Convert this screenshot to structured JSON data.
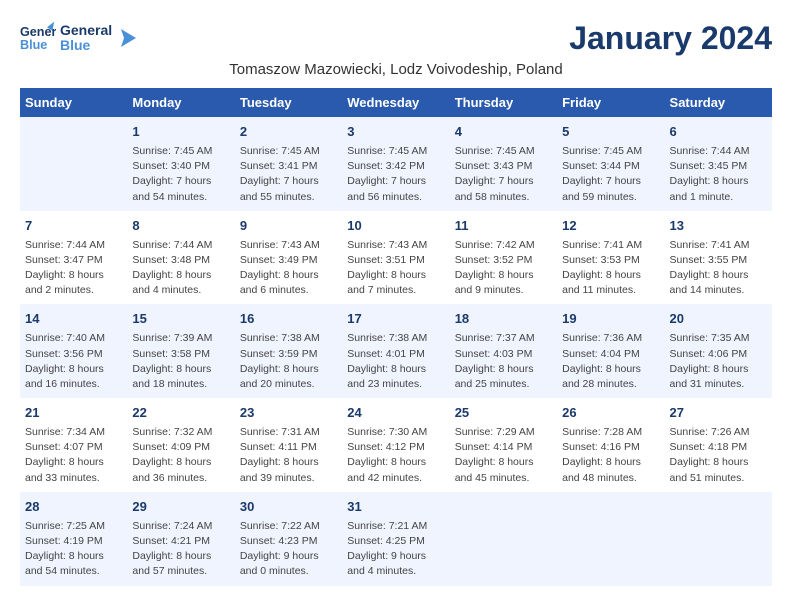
{
  "logo": {
    "line1": "General",
    "line2": "Blue"
  },
  "title": "January 2024",
  "subtitle": "Tomaszow Mazowiecki, Lodz Voivodeship, Poland",
  "days_of_week": [
    "Sunday",
    "Monday",
    "Tuesday",
    "Wednesday",
    "Thursday",
    "Friday",
    "Saturday"
  ],
  "weeks": [
    [
      {
        "day": "",
        "info": ""
      },
      {
        "day": "1",
        "info": "Sunrise: 7:45 AM\nSunset: 3:40 PM\nDaylight: 7 hours\nand 54 minutes."
      },
      {
        "day": "2",
        "info": "Sunrise: 7:45 AM\nSunset: 3:41 PM\nDaylight: 7 hours\nand 55 minutes."
      },
      {
        "day": "3",
        "info": "Sunrise: 7:45 AM\nSunset: 3:42 PM\nDaylight: 7 hours\nand 56 minutes."
      },
      {
        "day": "4",
        "info": "Sunrise: 7:45 AM\nSunset: 3:43 PM\nDaylight: 7 hours\nand 58 minutes."
      },
      {
        "day": "5",
        "info": "Sunrise: 7:45 AM\nSunset: 3:44 PM\nDaylight: 7 hours\nand 59 minutes."
      },
      {
        "day": "6",
        "info": "Sunrise: 7:44 AM\nSunset: 3:45 PM\nDaylight: 8 hours\nand 1 minute."
      }
    ],
    [
      {
        "day": "7",
        "info": "Sunrise: 7:44 AM\nSunset: 3:47 PM\nDaylight: 8 hours\nand 2 minutes."
      },
      {
        "day": "8",
        "info": "Sunrise: 7:44 AM\nSunset: 3:48 PM\nDaylight: 8 hours\nand 4 minutes."
      },
      {
        "day": "9",
        "info": "Sunrise: 7:43 AM\nSunset: 3:49 PM\nDaylight: 8 hours\nand 6 minutes."
      },
      {
        "day": "10",
        "info": "Sunrise: 7:43 AM\nSunset: 3:51 PM\nDaylight: 8 hours\nand 7 minutes."
      },
      {
        "day": "11",
        "info": "Sunrise: 7:42 AM\nSunset: 3:52 PM\nDaylight: 8 hours\nand 9 minutes."
      },
      {
        "day": "12",
        "info": "Sunrise: 7:41 AM\nSunset: 3:53 PM\nDaylight: 8 hours\nand 11 minutes."
      },
      {
        "day": "13",
        "info": "Sunrise: 7:41 AM\nSunset: 3:55 PM\nDaylight: 8 hours\nand 14 minutes."
      }
    ],
    [
      {
        "day": "14",
        "info": "Sunrise: 7:40 AM\nSunset: 3:56 PM\nDaylight: 8 hours\nand 16 minutes."
      },
      {
        "day": "15",
        "info": "Sunrise: 7:39 AM\nSunset: 3:58 PM\nDaylight: 8 hours\nand 18 minutes."
      },
      {
        "day": "16",
        "info": "Sunrise: 7:38 AM\nSunset: 3:59 PM\nDaylight: 8 hours\nand 20 minutes."
      },
      {
        "day": "17",
        "info": "Sunrise: 7:38 AM\nSunset: 4:01 PM\nDaylight: 8 hours\nand 23 minutes."
      },
      {
        "day": "18",
        "info": "Sunrise: 7:37 AM\nSunset: 4:03 PM\nDaylight: 8 hours\nand 25 minutes."
      },
      {
        "day": "19",
        "info": "Sunrise: 7:36 AM\nSunset: 4:04 PM\nDaylight: 8 hours\nand 28 minutes."
      },
      {
        "day": "20",
        "info": "Sunrise: 7:35 AM\nSunset: 4:06 PM\nDaylight: 8 hours\nand 31 minutes."
      }
    ],
    [
      {
        "day": "21",
        "info": "Sunrise: 7:34 AM\nSunset: 4:07 PM\nDaylight: 8 hours\nand 33 minutes."
      },
      {
        "day": "22",
        "info": "Sunrise: 7:32 AM\nSunset: 4:09 PM\nDaylight: 8 hours\nand 36 minutes."
      },
      {
        "day": "23",
        "info": "Sunrise: 7:31 AM\nSunset: 4:11 PM\nDaylight: 8 hours\nand 39 minutes."
      },
      {
        "day": "24",
        "info": "Sunrise: 7:30 AM\nSunset: 4:12 PM\nDaylight: 8 hours\nand 42 minutes."
      },
      {
        "day": "25",
        "info": "Sunrise: 7:29 AM\nSunset: 4:14 PM\nDaylight: 8 hours\nand 45 minutes."
      },
      {
        "day": "26",
        "info": "Sunrise: 7:28 AM\nSunset: 4:16 PM\nDaylight: 8 hours\nand 48 minutes."
      },
      {
        "day": "27",
        "info": "Sunrise: 7:26 AM\nSunset: 4:18 PM\nDaylight: 8 hours\nand 51 minutes."
      }
    ],
    [
      {
        "day": "28",
        "info": "Sunrise: 7:25 AM\nSunset: 4:19 PM\nDaylight: 8 hours\nand 54 minutes."
      },
      {
        "day": "29",
        "info": "Sunrise: 7:24 AM\nSunset: 4:21 PM\nDaylight: 8 hours\nand 57 minutes."
      },
      {
        "day": "30",
        "info": "Sunrise: 7:22 AM\nSunset: 4:23 PM\nDaylight: 9 hours\nand 0 minutes."
      },
      {
        "day": "31",
        "info": "Sunrise: 7:21 AM\nSunset: 4:25 PM\nDaylight: 9 hours\nand 4 minutes."
      },
      {
        "day": "",
        "info": ""
      },
      {
        "day": "",
        "info": ""
      },
      {
        "day": "",
        "info": ""
      }
    ]
  ]
}
